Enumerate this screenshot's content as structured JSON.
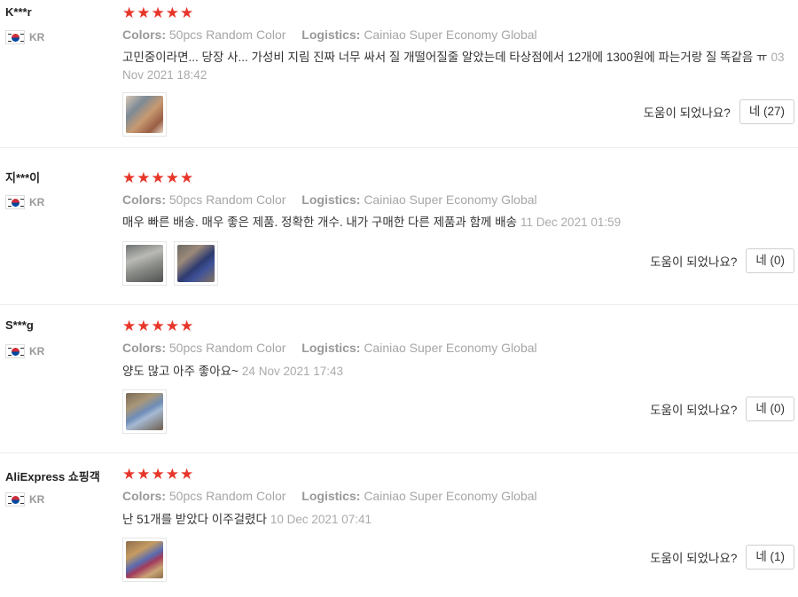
{
  "reviews": [
    {
      "user": "K***r",
      "country": "KR",
      "stars": "★★★★★",
      "rating": 5,
      "colors_label": "Colors:",
      "colors_value": "50pcs Random Color",
      "logistics_label": "Logistics:",
      "logistics_value": "Cainiao Super Economy Global",
      "text": "고민중이라면... 당장 사... 가성비 지림 진짜 너무 싸서 질 개떨어질줄 알았는데 타상점에서 12개에 1300원에 파는거랑 질 똑같음 ㅠ",
      "date": "03 Nov 2021 18:42",
      "helpful_label": "도움이 되었나요?",
      "yes_button": "네 (27)"
    },
    {
      "user": "지***이",
      "country": "KR",
      "stars": "★★★★★",
      "rating": 5,
      "colors_label": "Colors:",
      "colors_value": "50pcs Random Color",
      "logistics_label": "Logistics:",
      "logistics_value": "Cainiao Super Economy Global",
      "text": "매우 빠른 배송. 매우 좋은 제품. 정확한 개수. 내가 구매한 다른 제품과 함께 배송",
      "date": "11 Dec 2021 01:59",
      "helpful_label": "도움이 되었나요?",
      "yes_button": "네 (0)"
    },
    {
      "user": "S***g",
      "country": "KR",
      "stars": "★★★★★",
      "rating": 5,
      "colors_label": "Colors:",
      "colors_value": "50pcs Random Color",
      "logistics_label": "Logistics:",
      "logistics_value": "Cainiao Super Economy Global",
      "text": "양도 많고 아주 좋아요~",
      "date": "24 Nov 2021 17:43",
      "helpful_label": "도움이 되었나요?",
      "yes_button": "네 (0)"
    },
    {
      "user": "AliExpress 쇼핑객",
      "country": "KR",
      "stars": "★★★★★",
      "rating": 5,
      "colors_label": "Colors:",
      "colors_value": "50pcs Random Color",
      "logistics_label": "Logistics:",
      "logistics_value": "Cainiao Super Economy Global",
      "text": "난 51개를 받았다 이주걸렸다",
      "date": "10 Dec 2021 07:41",
      "helpful_label": "도움이 되었나요?",
      "yes_button": "네 (1)"
    }
  ],
  "colors": {
    "star": "#e8352a",
    "muted_text": "#a6a6a6",
    "divider": "#ececec"
  },
  "icons": {
    "flag": "south-korea-flag-icon",
    "star": "star-icon"
  }
}
